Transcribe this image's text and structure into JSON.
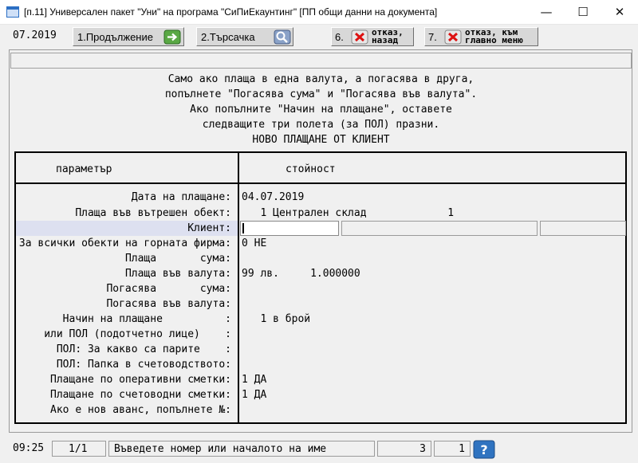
{
  "window": {
    "title": "[п.11] Универсален пакет \"Уни\" на програма \"СиПиЕкаунтинг\" [ПП общи данни на документа]",
    "minimize": "—",
    "maximize": "☐",
    "close": "✕"
  },
  "toolbar": {
    "date": "07.2019",
    "continue_label": "1.Продължение",
    "search_label": "2.Търсачка",
    "cancel_back_num": "6.",
    "cancel_back_line1": "отказ,",
    "cancel_back_line2": "назад",
    "cancel_main_num": "7.",
    "cancel_main_line1": "отказ, към",
    "cancel_main_line2": "главно меню"
  },
  "message": {
    "line1": "Само ако плаща в една валута, а погасява в друга,",
    "line2": "попълнете \"Погасява сума\" и \"Погасява във валута\".",
    "line3": "Ако попълните \"Начин на плащане\", оставете",
    "line4": "следващите три полета (за ПОЛ) празни.",
    "line5": "НОВО ПЛАЩАНЕ ОТ КЛИЕНТ"
  },
  "table": {
    "col_param": "параметър",
    "col_value": "стойност",
    "rows": [
      {
        "label": "Дата на плащане:",
        "value": "04.07.2019"
      },
      {
        "label": "Плаща във вътрешен обект:",
        "value": "   1 Централен склад             1"
      },
      {
        "label": "Клиент:",
        "value": ""
      },
      {
        "label": "За всички обекти на горната фирма:",
        "value": "0 НЕ"
      },
      {
        "label": "Плаща       сума:",
        "value": ""
      },
      {
        "label": "Плаща във валута:",
        "value": "99 лв.     1.000000"
      },
      {
        "label": "Погасява       сума:",
        "value": ""
      },
      {
        "label": "Погасява във валута:",
        "value": ""
      },
      {
        "label": "Начин на плащане          :",
        "value": "   1 в брой"
      },
      {
        "label": "или ПОЛ (подотчетно лице)    :",
        "value": ""
      },
      {
        "label": "ПОЛ: За какво са парите    :",
        "value": ""
      },
      {
        "label": "ПОЛ: Папка в счетоводството:",
        "value": ""
      },
      {
        "label": "Плащане по оперативни сметки:",
        "value": "1 ДА"
      },
      {
        "label": "Плащане по счетоводни сметки:",
        "value": "1 ДА"
      },
      {
        "label": "Ако е нов аванс, попълнете №:",
        "value": ""
      }
    ]
  },
  "status": {
    "time": "09:25",
    "page": "1/1",
    "hint": "Въведете номер или началото на име",
    "count": "3",
    "index": "1"
  }
}
